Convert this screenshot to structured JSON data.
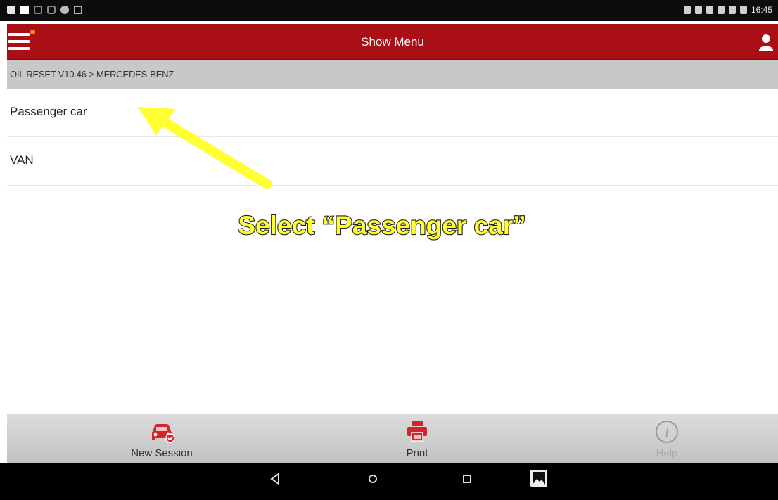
{
  "status_bar": {
    "time": "16:45"
  },
  "app_bar": {
    "title": "Show Menu",
    "accent_color": "#a90f15"
  },
  "breadcrumb": {
    "text": "OIL RESET V10.46 > MERCEDES-BENZ"
  },
  "menu_items": [
    {
      "label": "Passenger car"
    },
    {
      "label": "VAN"
    }
  ],
  "annotation": {
    "text": "Select “Passenger car”",
    "color": "#ffff33"
  },
  "bottom_bar": {
    "new_session": "New Session",
    "print": "Print",
    "help": "Help"
  }
}
